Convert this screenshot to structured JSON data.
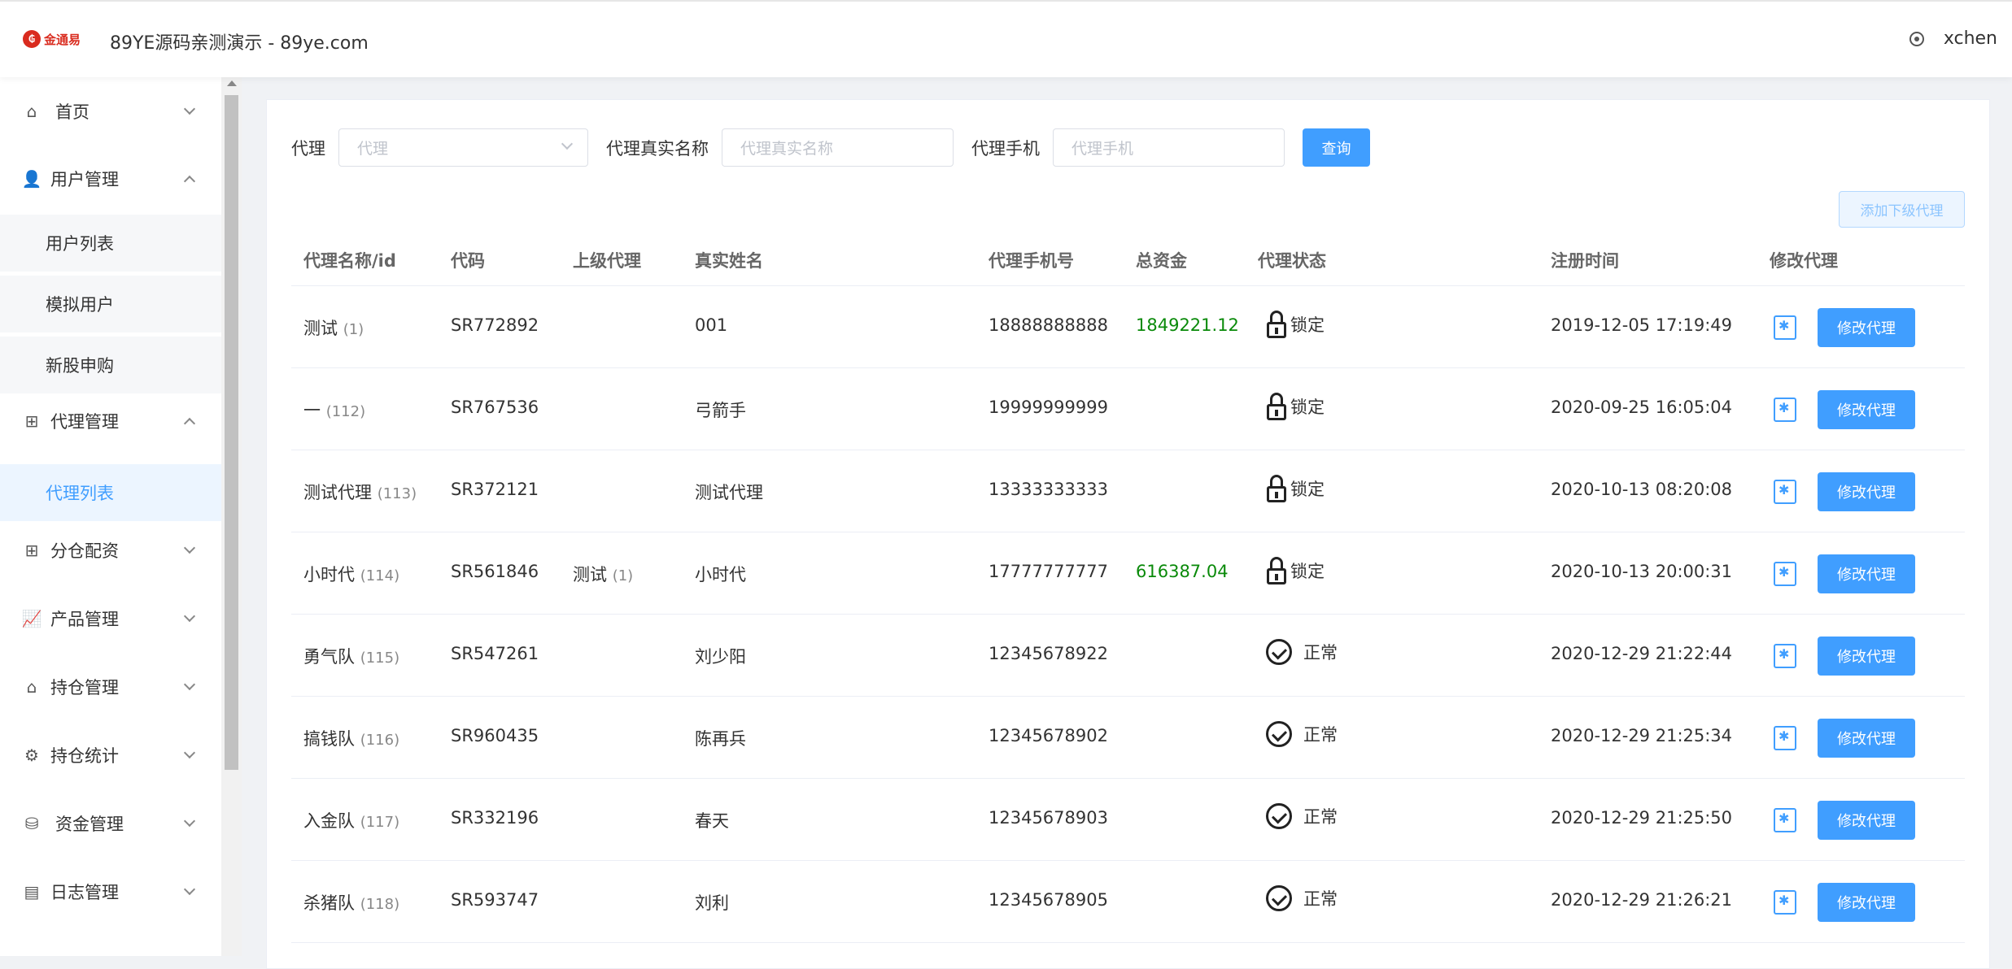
{
  "header": {
    "logo_text": "金通易",
    "title": "89YE源码亲测演示 - 89ye.com",
    "username": "xchen"
  },
  "sidebar": {
    "items": [
      {
        "label": "首页",
        "icon": "home-icon",
        "expanded": false
      },
      {
        "label": "用户管理",
        "icon": "user-manage-icon",
        "expanded": true,
        "children": [
          "用户列表",
          "模拟用户",
          "新股申购"
        ]
      },
      {
        "label": "代理管理",
        "icon": "org-icon",
        "expanded": true,
        "children": [
          "代理列表"
        ]
      },
      {
        "label": "分仓配资",
        "icon": "org-icon",
        "expanded": false
      },
      {
        "label": "产品管理",
        "icon": "chart-icon",
        "expanded": false
      },
      {
        "label": "持仓管理",
        "icon": "house-icon",
        "expanded": false
      },
      {
        "label": "持仓统计",
        "icon": "stats-icon",
        "expanded": false
      },
      {
        "label": "资金管理",
        "icon": "coins-icon",
        "expanded": false
      },
      {
        "label": "日志管理",
        "icon": "log-icon",
        "expanded": false
      }
    ],
    "active_child": "代理列表"
  },
  "filter": {
    "agent_label": "代理",
    "agent_placeholder": "代理",
    "realname_label": "代理真实名称",
    "realname_placeholder": "代理真实名称",
    "phone_label": "代理手机",
    "phone_placeholder": "代理手机",
    "query_label": "查询",
    "add_label": "添加下级代理"
  },
  "table": {
    "headers": [
      "代理名称/id",
      "代码",
      "上级代理",
      "真实姓名",
      "代理手机号",
      "总资金",
      "代理状态",
      "注册时间",
      "修改代理"
    ],
    "rows": [
      {
        "name": "测试",
        "id": "(1)",
        "code": "SR772892",
        "parent": "",
        "parent_id": "",
        "realname": "001",
        "phone": "18888888888",
        "funds": "1849221.12",
        "status": "锁定",
        "locked": true,
        "reg": "2019-12-05 17:19:49",
        "btn": "修改代理"
      },
      {
        "name": "一",
        "id": "(112)",
        "code": "SR767536",
        "parent": "",
        "parent_id": "",
        "realname": "弓箭手",
        "phone": "19999999999",
        "funds": "",
        "status": "锁定",
        "locked": true,
        "reg": "2020-09-25 16:05:04",
        "btn": "修改代理"
      },
      {
        "name": "测试代理",
        "id": "(113)",
        "code": "SR372121",
        "parent": "",
        "parent_id": "",
        "realname": "测试代理",
        "phone": "13333333333",
        "funds": "",
        "status": "锁定",
        "locked": true,
        "reg": "2020-10-13 08:20:08",
        "btn": "修改代理"
      },
      {
        "name": "小时代",
        "id": "(114)",
        "code": "SR561846",
        "parent": "测试",
        "parent_id": "(1)",
        "realname": "小时代",
        "phone": "17777777777",
        "funds": "616387.04",
        "status": "锁定",
        "locked": true,
        "reg": "2020-10-13 20:00:31",
        "btn": "修改代理"
      },
      {
        "name": "勇气队",
        "id": "(115)",
        "code": "SR547261",
        "parent": "",
        "parent_id": "",
        "realname": "刘少阳",
        "phone": "12345678922",
        "funds": "",
        "status": "正常",
        "locked": false,
        "reg": "2020-12-29 21:22:44",
        "btn": "修改代理"
      },
      {
        "name": "搞钱队",
        "id": "(116)",
        "code": "SR960435",
        "parent": "",
        "parent_id": "",
        "realname": "陈再兵",
        "phone": "12345678902",
        "funds": "",
        "status": "正常",
        "locked": false,
        "reg": "2020-12-29 21:25:34",
        "btn": "修改代理"
      },
      {
        "name": "入金队",
        "id": "(117)",
        "code": "SR332196",
        "parent": "",
        "parent_id": "",
        "realname": "春天",
        "phone": "12345678903",
        "funds": "",
        "status": "正常",
        "locked": false,
        "reg": "2020-12-29 21:25:50",
        "btn": "修改代理"
      },
      {
        "name": "杀猪队",
        "id": "(118)",
        "code": "SR593747",
        "parent": "",
        "parent_id": "",
        "realname": "刘利",
        "phone": "12345678905",
        "funds": "",
        "status": "正常",
        "locked": false,
        "reg": "2020-12-29 21:26:21",
        "btn": "修改代理"
      }
    ]
  },
  "colors": {
    "accent": "#409eff",
    "funds": "#0a8a0a"
  }
}
